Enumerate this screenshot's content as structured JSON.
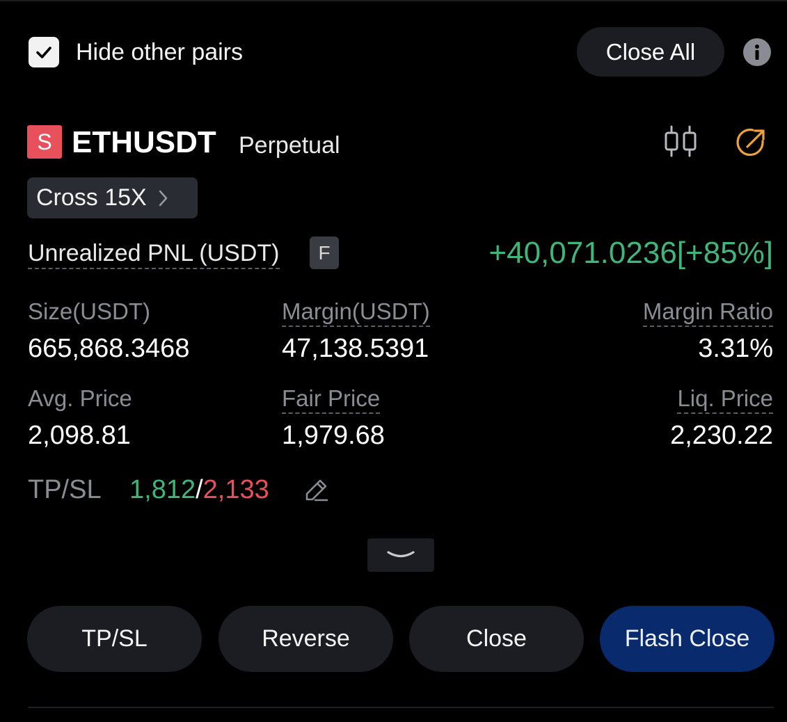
{
  "header": {
    "hide_other_pairs": "Hide other pairs",
    "hide_other_pairs_checked": true,
    "close_all": "Close All"
  },
  "position": {
    "side": "S",
    "symbol": "ETHUSDT",
    "contract_type": "Perpetual",
    "margin_mode": "Cross 15X",
    "pnl_label": "Unrealized PNL (USDT)",
    "pnl_badge": "F",
    "pnl_value": "+40,071.0236[+85%]",
    "stats": {
      "size_label": "Size(USDT)",
      "size_value": "665,868.3468",
      "margin_label": "Margin(USDT)",
      "margin_value": "47,138.5391",
      "margin_ratio_label": "Margin Ratio",
      "margin_ratio_value": "3.31%",
      "avg_price_label": "Avg. Price",
      "avg_price_value": "2,098.81",
      "fair_price_label": "Fair Price",
      "fair_price_value": "1,979.68",
      "liq_price_label": "Liq. Price",
      "liq_price_value": "2,230.22"
    },
    "tpsl": {
      "label": "TP/SL",
      "tp": "1,812",
      "separator": "/",
      "sl": "2,133"
    }
  },
  "actions": {
    "tpsl": "TP/SL",
    "reverse": "Reverse",
    "close": "Close",
    "flash_close": "Flash Close"
  },
  "icons": {
    "checkbox": "checkmark-icon",
    "info": "info-icon",
    "chart": "candlestick-chart-icon",
    "share": "share-arrow-icon",
    "chevron_right": "chevron-right-icon",
    "edit": "pencil-icon",
    "expand": "chevron-down-icon"
  },
  "colors": {
    "profit": "#3fb67c",
    "loss": "#e8505b",
    "accent_orange": "#f0a23a",
    "flash_close_bg": "#0a2a6e",
    "button_bg": "#1c1d22"
  }
}
